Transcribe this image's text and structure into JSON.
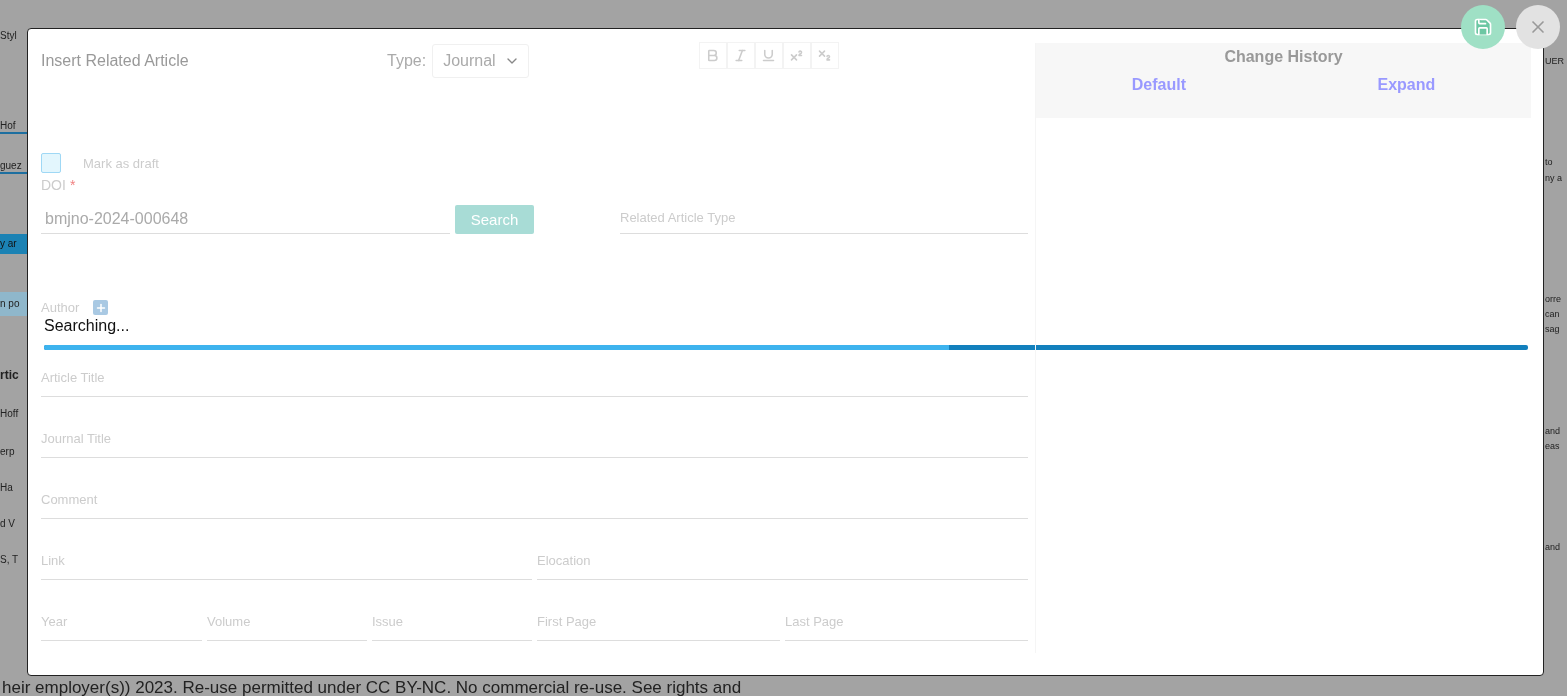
{
  "background": {
    "left_fragments": [
      {
        "text": "Styl",
        "kind": "plain"
      },
      {
        "text": "Hof",
        "kind": "field"
      },
      {
        "text": "guez",
        "kind": "field"
      },
      {
        "text": "y ar",
        "kind": "button"
      },
      {
        "text": "n po",
        "kind": "chip"
      },
      {
        "text": "rtic",
        "kind": "heading"
      },
      {
        "text": "Hoff",
        "kind": "plain"
      },
      {
        "text": "erp",
        "kind": "plain"
      },
      {
        "text": "Ha",
        "kind": "plain"
      },
      {
        "text": "d V",
        "kind": "plain"
      },
      {
        "text": "S, T",
        "kind": "plain"
      }
    ],
    "right_fragments": [
      {
        "text": "UER"
      },
      {
        "text": "to"
      },
      {
        "text": "ny a"
      },
      {
        "text": "orre"
      },
      {
        "text": "can"
      },
      {
        "text": "sag"
      },
      {
        "text": "and"
      },
      {
        "text": "eas"
      },
      {
        "text": "and"
      }
    ],
    "footer_text": "heir employer(s)) 2023. Re-use permitted under CC BY-NC. No commercial re-use. See rights and"
  },
  "dialog": {
    "title": "Insert Related Article",
    "type_label": "Type:",
    "type_value": "Journal",
    "draft": {
      "label": "Mark as draft",
      "checked": false
    },
    "doi": {
      "label": "DOI",
      "required_mark": "*",
      "value": "bmjno-2024-000648"
    },
    "search_button": "Search",
    "related_type": {
      "placeholder": "Related Article Type"
    },
    "author": {
      "label": "Author"
    },
    "status": "Searching...",
    "progress": {
      "level": 0.61
    },
    "field_rows": [
      [
        {
          "placeholder": "Article Title"
        }
      ],
      [
        {
          "placeholder": "Journal Title"
        }
      ],
      [
        {
          "placeholder": "Comment"
        }
      ],
      [
        {
          "placeholder": "Link"
        },
        {
          "placeholder": "Elocation"
        }
      ],
      [
        {
          "placeholder": "Year"
        },
        {
          "placeholder": "Volume"
        },
        {
          "placeholder": "Issue"
        },
        {
          "placeholder": "First Page"
        },
        {
          "placeholder": "Last Page"
        }
      ]
    ],
    "history": {
      "title": "Change History",
      "links": [
        "Default",
        "Expand"
      ]
    }
  }
}
